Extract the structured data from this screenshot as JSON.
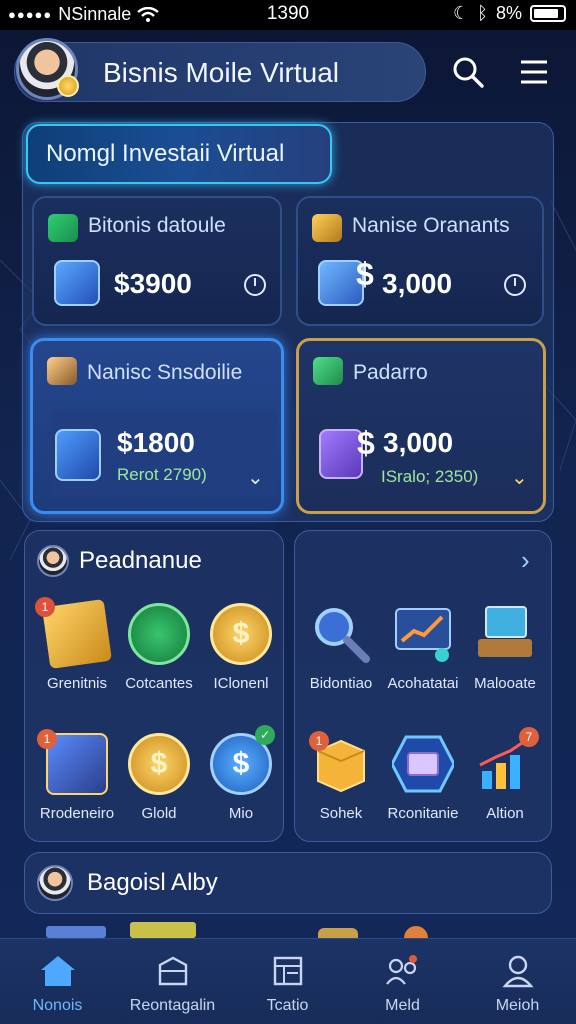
{
  "status_bar": {
    "signal": "●●●●●",
    "carrier": "NSinnale",
    "time": "1390",
    "battery": "8%"
  },
  "header": {
    "title": "Bisnis Moile Virtual",
    "avatar": "user-avatar",
    "icons": [
      "search-icon",
      "menu-icon"
    ]
  },
  "main": {
    "section_title": "Nomgl Investaii Virtual",
    "cards": [
      {
        "title": "Bitonis datoule",
        "value": "$3900",
        "icon": "money-icon",
        "image": "blue-cube-icon"
      },
      {
        "title": "Nanise Oranants",
        "value": "3,000",
        "icon": "chest-icon",
        "image": "globe-cube-icon"
      },
      {
        "title": "Nanisc Snsdoilie",
        "value": "$1800",
        "sub": "Rerot 2790)",
        "icon": "person-icon",
        "image": "blue-tile-icon"
      },
      {
        "title": "Padarro",
        "value": "3,000",
        "sub": "ISralo; 2350)",
        "icon": "plant-icon",
        "image": "purple-tile-icon"
      }
    ]
  },
  "peadnanue": {
    "title": "Peadnanue",
    "items": [
      {
        "label": "Grenitnis",
        "icon": "gold-box-icon",
        "badge": "1"
      },
      {
        "label": "Cotcantes",
        "icon": "green-coin-icon"
      },
      {
        "label": "IClonenl",
        "icon": "gold-dollar-coin-icon"
      },
      {
        "label": "Rrodeneiro",
        "icon": "machine-icon",
        "badge": "1"
      },
      {
        "label": "Glold",
        "icon": "gold-coin-icon"
      },
      {
        "label": "Mio",
        "icon": "blue-dollar-coin-icon",
        "badge": "✓"
      }
    ]
  },
  "right_panel": {
    "items": [
      {
        "label": "Bidontiao",
        "icon": "magnifier-icon"
      },
      {
        "label": "Acohatatai",
        "icon": "chart-board-icon"
      },
      {
        "label": "Malooate",
        "icon": "laptop-icon"
      },
      {
        "label": "Sohek",
        "icon": "box-icon",
        "badge": "1"
      },
      {
        "label": "Rconitanie",
        "icon": "cash-stack-icon"
      },
      {
        "label": "Altion",
        "icon": "bar-chart-icon",
        "badge": "7"
      }
    ]
  },
  "bagoisl": {
    "title": "Bagoisl Alby"
  },
  "bottom_nav": [
    {
      "label": "Nonois",
      "icon": "home-icon",
      "active": true
    },
    {
      "label": "Reontagalin",
      "icon": "folder-icon"
    },
    {
      "label": "Tcatio",
      "icon": "document-icon"
    },
    {
      "label": "Meld",
      "icon": "people-icon"
    },
    {
      "label": "Meioh",
      "icon": "profile-icon"
    }
  ]
}
